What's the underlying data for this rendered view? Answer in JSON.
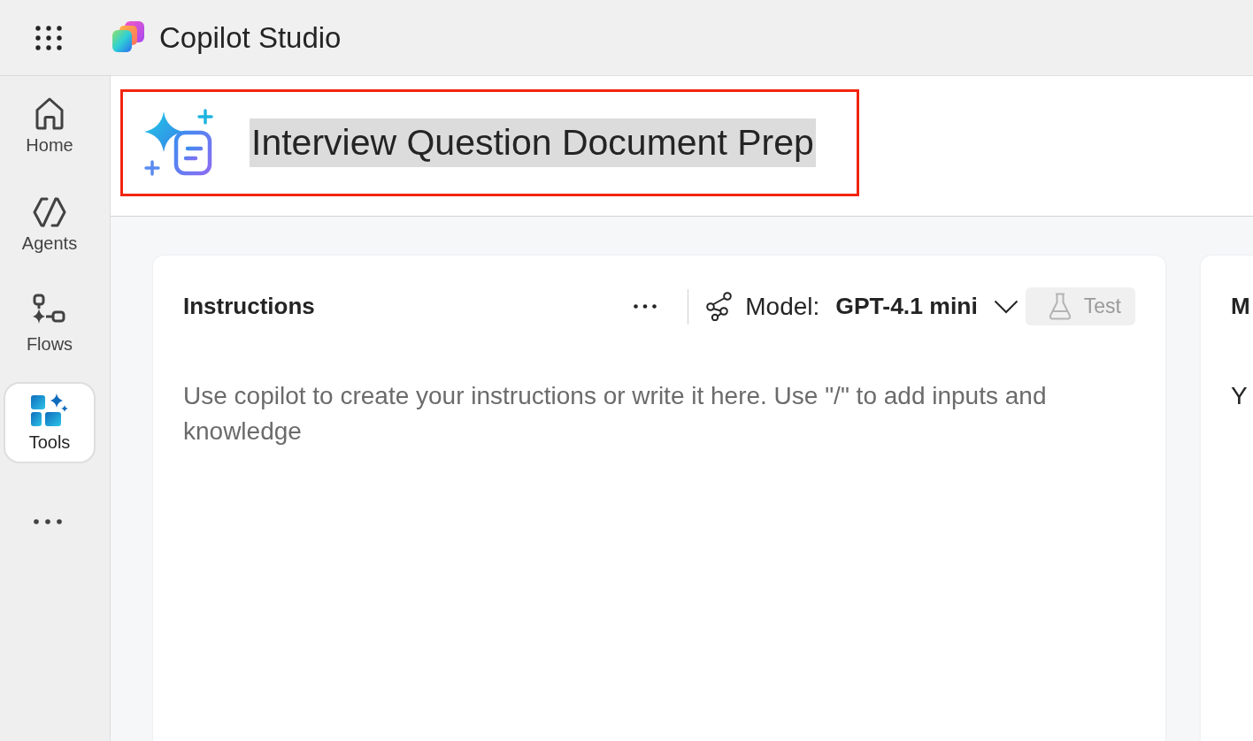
{
  "app_bar": {
    "title": "Copilot Studio"
  },
  "nav": {
    "items": [
      {
        "label": "Home",
        "selected": false
      },
      {
        "label": "Agents",
        "selected": false
      },
      {
        "label": "Flows",
        "selected": false
      },
      {
        "label": "Tools",
        "selected": true
      }
    ]
  },
  "header": {
    "agent_name": "Interview Question Document Prep",
    "name_selected": true,
    "highlighted": true
  },
  "instructions": {
    "title": "Instructions",
    "model_label": "Model:",
    "model": "GPT-4.1 mini",
    "test_button": {
      "label": "Test",
      "disabled": true
    },
    "placeholder": "Use copilot to create your instructions or write it here. Use \"/\" to add inputs and knowledge"
  },
  "side_card": {
    "title": "M",
    "text": "Y"
  }
}
